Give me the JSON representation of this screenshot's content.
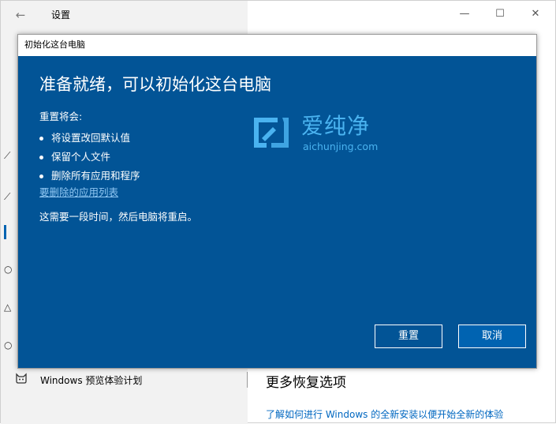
{
  "settings": {
    "title": "设置",
    "back_icon": "←",
    "minimize_icon": "—",
    "maximize_icon": "☐",
    "close_icon": "✕",
    "insider_label": "Windows 预览体验计划",
    "more_title": "更多恢复选项",
    "more_link": "了解如何进行 Windows 的全新安装以便开始全新的体验"
  },
  "dialog": {
    "title": "初始化这台电脑",
    "heading": "准备就绪，可以初始化这台电脑",
    "intro": "重置将会:",
    "bullets": [
      "将设置改回默认值",
      "保留个人文件",
      "删除所有应用和程序"
    ],
    "remove_link": "要删除的应用列表",
    "notice": "这需要一段时间，然后电脑将重启。",
    "reset_label": "重置",
    "cancel_label": "取消"
  },
  "watermark": {
    "cn": "爱纯净",
    "en": "aichunjing.com"
  },
  "colors": {
    "dialog_bg": "#025496",
    "link": "#8fc6f2",
    "watermark": "#4ab3f0",
    "cancel_bg": "#0063b1"
  }
}
